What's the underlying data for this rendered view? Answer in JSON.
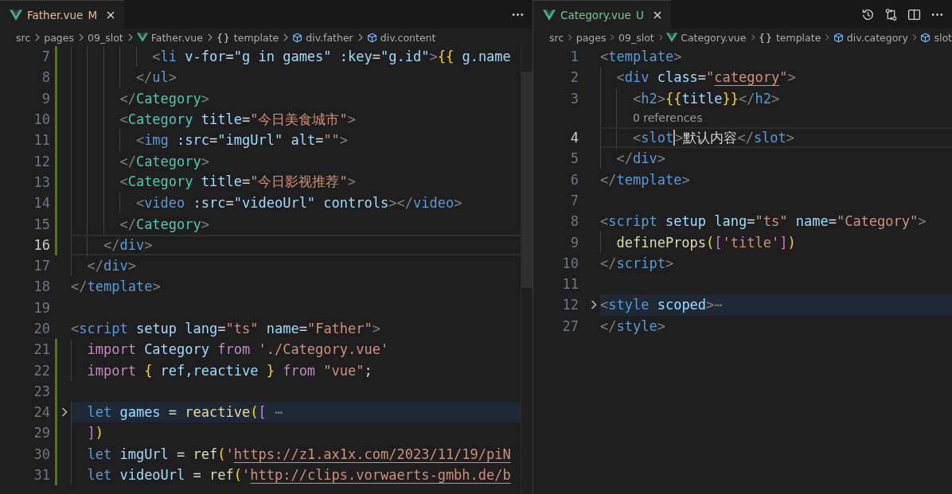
{
  "editors": [
    {
      "tab": {
        "file": "Father.vue",
        "status": "M",
        "kind": "modified",
        "selected": true
      },
      "actions": [
        {
          "kind": "more"
        }
      ],
      "breadcrumbs": [
        {
          "label": "src",
          "kind": "folder"
        },
        {
          "label": "pages",
          "kind": "folder"
        },
        {
          "label": "09_slot",
          "kind": "folder"
        },
        {
          "label": "Father.vue",
          "kind": "vue"
        },
        {
          "label": "template",
          "kind": "object",
          "glyph": "{}"
        },
        {
          "label": "div.father",
          "kind": "element"
        },
        {
          "label": "div.content",
          "kind": "element"
        }
      ],
      "lines": [
        {
          "number": "7",
          "changed": true,
          "tokens": [
            {
              "text": "          <",
              "kind": "punct"
            },
            {
              "text": "li",
              "kind": "tag"
            },
            {
              "text": " v-for",
              "kind": "attr"
            },
            {
              "text": "=",
              "kind": "plain"
            },
            {
              "text": "\"g in games\"",
              "kind": "var"
            },
            {
              "text": " :key",
              "kind": "attr"
            },
            {
              "text": "=",
              "kind": "plain"
            },
            {
              "text": "\"g.id\"",
              "kind": "var"
            },
            {
              "text": ">",
              "kind": "punct"
            },
            {
              "text": "{{",
              "kind": "brace"
            },
            {
              "text": " g.name",
              "kind": "var"
            }
          ]
        },
        {
          "number": "8",
          "changed": true,
          "tokens": [
            {
              "text": "        </",
              "kind": "punct"
            },
            {
              "text": "ul",
              "kind": "tag"
            },
            {
              "text": ">",
              "kind": "punct"
            }
          ]
        },
        {
          "number": "9",
          "changed": true,
          "tokens": [
            {
              "text": "      </",
              "kind": "punct"
            },
            {
              "text": "Category",
              "kind": "component"
            },
            {
              "text": ">",
              "kind": "punct"
            }
          ]
        },
        {
          "number": "10",
          "changed": true,
          "tokens": [
            {
              "text": "      <",
              "kind": "punct"
            },
            {
              "text": "Category",
              "kind": "component"
            },
            {
              "text": " title",
              "kind": "attr"
            },
            {
              "text": "=",
              "kind": "plain"
            },
            {
              "text": "\"今日美食城市\"",
              "kind": "string"
            },
            {
              "text": ">",
              "kind": "punct"
            }
          ]
        },
        {
          "number": "11",
          "changed": true,
          "tokens": [
            {
              "text": "        <",
              "kind": "punct"
            },
            {
              "text": "img",
              "kind": "tag"
            },
            {
              "text": " :src",
              "kind": "attr"
            },
            {
              "text": "=",
              "kind": "plain"
            },
            {
              "text": "\"imgUrl\"",
              "kind": "var"
            },
            {
              "text": " alt",
              "kind": "attr"
            },
            {
              "text": "=",
              "kind": "plain"
            },
            {
              "text": "\"\"",
              "kind": "string"
            },
            {
              "text": ">",
              "kind": "punct"
            }
          ]
        },
        {
          "number": "12",
          "changed": true,
          "tokens": [
            {
              "text": "      </",
              "kind": "punct"
            },
            {
              "text": "Category",
              "kind": "component"
            },
            {
              "text": ">",
              "kind": "punct"
            }
          ]
        },
        {
          "number": "13",
          "changed": true,
          "tokens": [
            {
              "text": "      <",
              "kind": "punct"
            },
            {
              "text": "Category",
              "kind": "component"
            },
            {
              "text": " title",
              "kind": "attr"
            },
            {
              "text": "=",
              "kind": "plain"
            },
            {
              "text": "\"今日影视推荐\"",
              "kind": "string"
            },
            {
              "text": ">",
              "kind": "punct"
            }
          ]
        },
        {
          "number": "14",
          "changed": true,
          "tokens": [
            {
              "text": "        <",
              "kind": "punct"
            },
            {
              "text": "video",
              "kind": "tag"
            },
            {
              "text": " :src",
              "kind": "attr"
            },
            {
              "text": "=",
              "kind": "plain"
            },
            {
              "text": "\"videoUrl\"",
              "kind": "var"
            },
            {
              "text": " controls",
              "kind": "attr"
            },
            {
              "text": "></",
              "kind": "punct"
            },
            {
              "text": "video",
              "kind": "tag"
            },
            {
              "text": ">",
              "kind": "punct"
            }
          ]
        },
        {
          "number": "15",
          "changed": true,
          "tokens": [
            {
              "text": "      </",
              "kind": "punct"
            },
            {
              "text": "Category",
              "kind": "component"
            },
            {
              "text": ">",
              "kind": "punct"
            }
          ]
        },
        {
          "number": "16",
          "changed": true,
          "current": true,
          "tokens": [
            {
              "text": "    </",
              "kind": "punct"
            },
            {
              "text": "div",
              "kind": "tag"
            },
            {
              "text": ">",
              "kind": "punct"
            }
          ]
        },
        {
          "number": "17",
          "tokens": [
            {
              "text": "  </",
              "kind": "punct"
            },
            {
              "text": "div",
              "kind": "tag"
            },
            {
              "text": ">",
              "kind": "punct"
            }
          ]
        },
        {
          "number": "18",
          "tokens": [
            {
              "text": "</",
              "kind": "punct"
            },
            {
              "text": "template",
              "kind": "tag"
            },
            {
              "text": ">",
              "kind": "punct"
            }
          ]
        },
        {
          "number": "19"
        },
        {
          "number": "20",
          "tokens": [
            {
              "text": "<",
              "kind": "punct"
            },
            {
              "text": "script",
              "kind": "tag"
            },
            {
              "text": " setup lang",
              "kind": "attr"
            },
            {
              "text": "=",
              "kind": "plain"
            },
            {
              "text": "\"ts\"",
              "kind": "string"
            },
            {
              "text": " name",
              "kind": "attr"
            },
            {
              "text": "=",
              "kind": "plain"
            },
            {
              "text": "\"Father\"",
              "kind": "string"
            },
            {
              "text": ">",
              "kind": "punct"
            }
          ]
        },
        {
          "number": "21",
          "changed": true,
          "tokens": [
            {
              "text": "  import",
              "kind": "keyword"
            },
            {
              "text": " Category ",
              "kind": "var"
            },
            {
              "text": "from",
              "kind": "keyword"
            },
            {
              "text": " './Category.vue'",
              "kind": "string"
            }
          ]
        },
        {
          "number": "22",
          "changed": true,
          "tokens": [
            {
              "text": "  import",
              "kind": "keyword"
            },
            {
              "text": " {",
              "kind": "brace"
            },
            {
              "text": " ref,reactive ",
              "kind": "var"
            },
            {
              "text": "} ",
              "kind": "brace"
            },
            {
              "text": "from",
              "kind": "keyword"
            },
            {
              "text": " \"vue\"",
              "kind": "string"
            },
            {
              "text": ";",
              "kind": "plain"
            }
          ]
        },
        {
          "number": "23",
          "changed": true
        },
        {
          "number": "24",
          "changed": true,
          "folded": true,
          "tokens": [
            {
              "text": "  let",
              "kind": "storage"
            },
            {
              "text": " games ",
              "kind": "var"
            },
            {
              "text": "= ",
              "kind": "plain"
            },
            {
              "text": "reactive",
              "kind": "func"
            },
            {
              "text": "(",
              "kind": "brace"
            },
            {
              "text": "[",
              "kind": "bracket"
            },
            {
              "text": " ⋯",
              "kind": "punct"
            }
          ]
        },
        {
          "number": "29",
          "changed": true,
          "tokens": [
            {
              "text": "  ]",
              "kind": "bracket"
            },
            {
              "text": ")",
              "kind": "brace"
            }
          ]
        },
        {
          "number": "30",
          "changed": true,
          "tokens": [
            {
              "text": "  let",
              "kind": "storage"
            },
            {
              "text": " imgUrl ",
              "kind": "var"
            },
            {
              "text": "= ",
              "kind": "plain"
            },
            {
              "text": "ref",
              "kind": "func"
            },
            {
              "text": "(",
              "kind": "brace"
            },
            {
              "text": "'",
              "kind": "string"
            },
            {
              "text": "https://z1.ax1x.com/2023/11/19/piN",
              "kind": "string",
              "underline": true
            }
          ]
        },
        {
          "number": "31",
          "changed": true,
          "tokens": [
            {
              "text": "  let",
              "kind": "storage"
            },
            {
              "text": " videoUrl ",
              "kind": "var"
            },
            {
              "text": "= ",
              "kind": "plain"
            },
            {
              "text": "ref",
              "kind": "func"
            },
            {
              "text": "(",
              "kind": "brace"
            },
            {
              "text": "'",
              "kind": "string"
            },
            {
              "text": "http://clips.vorwaerts-gmbh.de/b",
              "kind": "string",
              "underline": true
            }
          ]
        }
      ]
    },
    {
      "tab": {
        "file": "Category.vue",
        "status": "U",
        "kind": "untracked",
        "selected": true
      },
      "actions": [
        {
          "kind": "history"
        },
        {
          "kind": "compare"
        },
        {
          "kind": "split"
        },
        {
          "kind": "more"
        }
      ],
      "breadcrumbs": [
        {
          "label": "src",
          "kind": "folder"
        },
        {
          "label": "pages",
          "kind": "folder"
        },
        {
          "label": "09_slot",
          "kind": "folder"
        },
        {
          "label": "Category.vue",
          "kind": "vue"
        },
        {
          "label": "template",
          "kind": "object",
          "glyph": "{}"
        },
        {
          "label": "div.category",
          "kind": "element"
        },
        {
          "label": "slot",
          "kind": "element"
        }
      ],
      "lines": [
        {
          "number": "1",
          "tokens": [
            {
              "text": "<",
              "kind": "punct"
            },
            {
              "text": "template",
              "kind": "tag"
            },
            {
              "text": ">",
              "kind": "punct"
            }
          ]
        },
        {
          "number": "2",
          "tokens": [
            {
              "text": "  <",
              "kind": "punct"
            },
            {
              "text": "div",
              "kind": "tag"
            },
            {
              "text": " class",
              "kind": "attr"
            },
            {
              "text": "=",
              "kind": "plain"
            },
            {
              "text": "\"",
              "kind": "string"
            },
            {
              "text": "category",
              "kind": "string",
              "underline": true
            },
            {
              "text": "\"",
              "kind": "string"
            },
            {
              "text": ">",
              "kind": "punct"
            }
          ]
        },
        {
          "number": "3",
          "tokens": [
            {
              "text": "    <",
              "kind": "punct"
            },
            {
              "text": "h2",
              "kind": "tag"
            },
            {
              "text": ">",
              "kind": "punct"
            },
            {
              "text": "{{",
              "kind": "brace"
            },
            {
              "text": "title",
              "kind": "var"
            },
            {
              "text": "}}",
              "kind": "brace"
            },
            {
              "text": "</",
              "kind": "punct"
            },
            {
              "text": "h2",
              "kind": "tag"
            },
            {
              "text": ">",
              "kind": "punct"
            }
          ]
        },
        {
          "number": "4",
          "current": true,
          "codelens": "0 references",
          "tokens": [
            {
              "text": "    <",
              "kind": "punct"
            },
            {
              "text": "slot",
              "kind": "tag",
              "cursor": true
            },
            {
              "text": ">",
              "kind": "punct"
            },
            {
              "text": "默认内容",
              "kind": "plain"
            },
            {
              "text": "</",
              "kind": "punct"
            },
            {
              "text": "slot",
              "kind": "tag"
            },
            {
              "text": ">",
              "kind": "punct"
            }
          ]
        },
        {
          "number": "5",
          "tokens": [
            {
              "text": "  </",
              "kind": "punct"
            },
            {
              "text": "div",
              "kind": "tag"
            },
            {
              "text": ">",
              "kind": "punct"
            }
          ]
        },
        {
          "number": "6",
          "tokens": [
            {
              "text": "</",
              "kind": "punct"
            },
            {
              "text": "template",
              "kind": "tag"
            },
            {
              "text": ">",
              "kind": "punct"
            }
          ]
        },
        {
          "number": "7"
        },
        {
          "number": "8",
          "tokens": [
            {
              "text": "<",
              "kind": "punct"
            },
            {
              "text": "script",
              "kind": "tag"
            },
            {
              "text": " setup lang",
              "kind": "attr"
            },
            {
              "text": "=",
              "kind": "plain"
            },
            {
              "text": "\"ts\"",
              "kind": "string"
            },
            {
              "text": " name",
              "kind": "attr"
            },
            {
              "text": "=",
              "kind": "plain"
            },
            {
              "text": "\"Category\"",
              "kind": "string"
            },
            {
              "text": ">",
              "kind": "punct"
            }
          ]
        },
        {
          "number": "9",
          "tokens": [
            {
              "text": "  defineProps",
              "kind": "func"
            },
            {
              "text": "(",
              "kind": "brace"
            },
            {
              "text": "[",
              "kind": "bracket"
            },
            {
              "text": "'title'",
              "kind": "string"
            },
            {
              "text": "]",
              "kind": "bracket"
            },
            {
              "text": ")",
              "kind": "brace"
            }
          ]
        },
        {
          "number": "10",
          "tokens": [
            {
              "text": "</",
              "kind": "punct"
            },
            {
              "text": "script",
              "kind": "tag"
            },
            {
              "text": ">",
              "kind": "punct"
            }
          ]
        },
        {
          "number": "11"
        },
        {
          "number": "12",
          "folded": true,
          "tokens": [
            {
              "text": "<",
              "kind": "punct"
            },
            {
              "text": "style",
              "kind": "tag"
            },
            {
              "text": " scoped",
              "kind": "attr"
            },
            {
              "text": ">",
              "kind": "punct"
            },
            {
              "text": "⋯",
              "kind": "punct"
            }
          ]
        },
        {
          "number": "27",
          "tokens": [
            {
              "text": "</",
              "kind": "punct"
            },
            {
              "text": "style",
              "kind": "tag"
            },
            {
              "text": ">",
              "kind": "punct"
            }
          ]
        }
      ]
    }
  ]
}
